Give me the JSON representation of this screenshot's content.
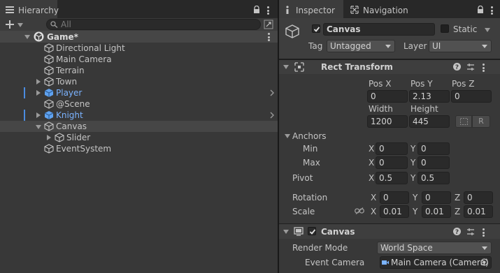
{
  "hierarchy": {
    "tab_label": "Hierarchy",
    "search_placeholder": "All",
    "scene_name": "Game*",
    "items": [
      {
        "label": "Directional Light"
      },
      {
        "label": "Main Camera"
      },
      {
        "label": "Terrain"
      },
      {
        "label": "Town"
      },
      {
        "label": "Player"
      },
      {
        "label": "@Scene"
      },
      {
        "label": "Knight"
      },
      {
        "label": "Canvas"
      },
      {
        "label": "Slider"
      },
      {
        "label": "EventSystem"
      }
    ]
  },
  "inspector": {
    "tabs": [
      {
        "label": "Inspector"
      },
      {
        "label": "Navigation"
      }
    ],
    "object_name": "Canvas",
    "static_label": "Static",
    "tag_label": "Tag",
    "tag_value": "Untagged",
    "layer_label": "Layer",
    "layer_value": "UI",
    "rect_transform": {
      "title": "Rect Transform",
      "pos_x_label": "Pos X",
      "pos_y_label": "Pos Y",
      "pos_z_label": "Pos Z",
      "pos_x": "0",
      "pos_y": "2.13",
      "pos_z": "0",
      "width_label": "Width",
      "height_label": "Height",
      "width": "1200",
      "height": "445",
      "raw_button": "R",
      "anchors_label": "Anchors",
      "min_label": "Min",
      "max_label": "Max",
      "min_x": "0",
      "min_y": "0",
      "max_x": "0",
      "max_y": "0",
      "pivot_label": "Pivot",
      "pivot_x": "0.5",
      "pivot_y": "0.5",
      "rotation_label": "Rotation",
      "rot_x": "0",
      "rot_y": "0",
      "rot_z": "0",
      "scale_label": "Scale",
      "scale_x": "0.01",
      "scale_y": "0.01",
      "scale_z": "0.01",
      "axis_x": "X",
      "axis_y": "Y",
      "axis_z": "Z"
    },
    "canvas": {
      "title": "Canvas",
      "render_mode_label": "Render Mode",
      "render_mode_value": "World Space",
      "event_camera_label": "Event Camera",
      "event_camera_value": "Main Camera (Camera)"
    }
  },
  "colors": {
    "panel_bg": "#383838",
    "tab_bar": "#282828",
    "field_bg": "#2a2a2a",
    "prefab_blue": "#7bb3ff",
    "selection_hl": "#464646"
  }
}
